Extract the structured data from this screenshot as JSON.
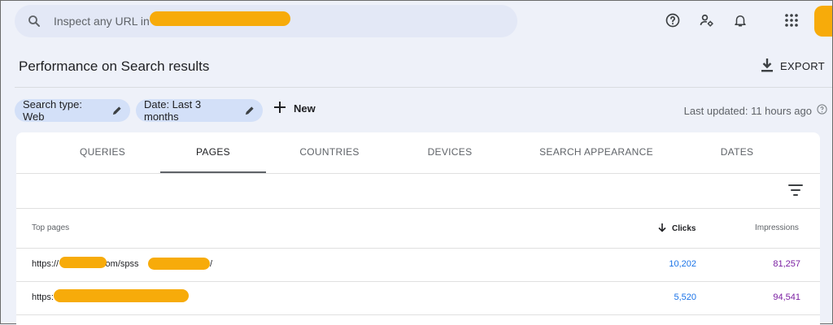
{
  "search": {
    "placeholder": "Inspect any URL in"
  },
  "header": {
    "title": "Performance on Search results",
    "export_label": "EXPORT"
  },
  "filters": {
    "search_type": "Search type: Web",
    "date": "Date: Last 3 months",
    "new_label": "New",
    "last_updated": "Last updated: 11 hours ago"
  },
  "tabs": [
    {
      "label": "QUERIES"
    },
    {
      "label": "PAGES"
    },
    {
      "label": "COUNTRIES"
    },
    {
      "label": "DEVICES"
    },
    {
      "label": "SEARCH APPEARANCE"
    },
    {
      "label": "DATES"
    }
  ],
  "active_tab": "PAGES",
  "table": {
    "columns": {
      "page": "Top pages",
      "clicks": "Clicks",
      "impressions": "Impressions"
    },
    "sorted_by": "Clicks",
    "rows": [
      {
        "url_start": "https://",
        "url_mid": ".com/spss",
        "url_end": "/",
        "clicks": "10,202",
        "impressions": "81,257"
      },
      {
        "url_start": "https:",
        "url_mid": "",
        "url_end": "",
        "clicks": "5,520",
        "impressions": "94,541"
      }
    ]
  },
  "colors": {
    "accent_clicks": "#1a73e8",
    "accent_impressions": "#7b1fa2",
    "chip_bg": "#d3e0f8",
    "redaction": "#f7ab0a"
  }
}
